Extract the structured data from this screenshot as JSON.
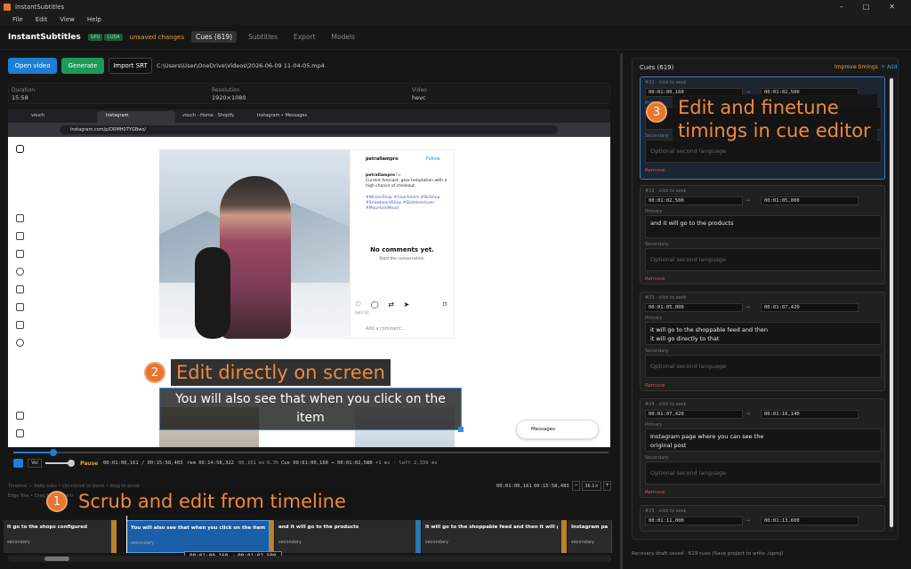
{
  "window": {
    "title": "InstantSubtitles",
    "controls": [
      "–",
      "□",
      "✕"
    ]
  },
  "menu": [
    "File",
    "Edit",
    "View",
    "Help"
  ],
  "header": {
    "app_name": "InstantSubtitles",
    "badge_gpu": "GPU",
    "badge_cuda": "CUDA",
    "unsaved": "unsaved changes",
    "tabs": [
      "Cues (619)",
      "Subtitles",
      "Export",
      "Models"
    ]
  },
  "toolbar": {
    "open_video": "Open video",
    "generate": "Generate",
    "import_srt": "Import SRT",
    "file_path": "C:\\Users\\User\\OneDrive\\Videos\\2026-06-09 11-04-05.mp4"
  },
  "info": {
    "duration_label": "Duration",
    "duration_value": "15:58",
    "resolution_label": "Resolution",
    "resolution_value": "1920×1080",
    "video_label": "Video",
    "video_value": "hevc"
  },
  "browser": {
    "tab1": "vouch",
    "tab2": "Instagram",
    "tab3": "vouch - Home · Shopify",
    "tab4": "Instagram • Messages",
    "url": "instagram.com/p/DRMH07YGBwo/"
  },
  "post": {
    "username": "petrallampro",
    "follow": "Follow",
    "caption_user": "petrallampro",
    "caption_time": "7w",
    "caption": "Current forecast: gear temptation with a high chance of checkout.",
    "hashtags": "#WinterShop #GearAddict #SkiShop #SnowboardShop #SkiAdventurer #MountainMood",
    "no_comments": "No comments yet.",
    "start_conv": "Start the conversation.",
    "date": "April 10",
    "add_comment": "Add a comment...",
    "messages": "Messages"
  },
  "subtitle_overlay": "You will also see that when you click on the item",
  "player": {
    "pause": "Pause",
    "time": "00:01:00,161 / 00:15:58,483",
    "remaining": "rem 00:14:58,322",
    "rate": "00,161 ms",
    "fps": "6.3%",
    "cue_info": "Cue 00:01:00,160 → 00:01:02,500",
    "offset": "in +1 ms · left 2,339 ms",
    "volume": "Vol"
  },
  "timeline": {
    "label": "Timeline — body subs • ctrl+scroll to zoom • drag to scrub",
    "sub_label": "Edge fine • Drag the edges to trim",
    "time_readout": "00:01:00,161",
    "end_readout": "00:15:58,483",
    "zoom": "36.1×",
    "range_readout": "00:01:00.160 → 00:01:02.500",
    "segments": [
      {
        "text": "it go to the shops configured",
        "sec": "secondary"
      },
      {
        "text": "You will also see that when you click on the item",
        "sec": "secondary"
      },
      {
        "text": "and it will go to the products",
        "sec": "secondary"
      },
      {
        "text": "it will go to the shoppable feed and then it will go directly t…",
        "sec": "secondary"
      },
      {
        "text": "Instagram page w…",
        "sec": "secondary"
      }
    ]
  },
  "cues_panel": {
    "title": "Cues (619)",
    "improve": "Improve timings",
    "add": "+ Add",
    "primary_label": "Primary",
    "secondary_label": "Secondary",
    "secondary_placeholder": "Optional second language",
    "remove": "Remove",
    "cues": [
      {
        "title": "#21 · click to seek",
        "start": "00:01:00,160",
        "end": "00:01:02,500",
        "primary": ""
      },
      {
        "title": "#22 · click to seek",
        "start": "00:01:02,500",
        "end": "00:01:05,000",
        "primary": "and it will go to the products"
      },
      {
        "title": "#23 · click to seek",
        "start": "00:01:05,000",
        "end": "00:01:07,420",
        "primary": "it will go to the shoppable feed and then\nit will go directly to that"
      },
      {
        "title": "#24 · click to seek",
        "start": "00:01:07,420",
        "end": "00:01:10,140",
        "primary": "Instagram page where you can see the\noriginal post"
      },
      {
        "title": "#25 · click to seek",
        "start": "00:01:11,000",
        "end": "00:01:13,600"
      }
    ]
  },
  "status": "Recovery draft saved · 619 cues (Save project to write .isproj)",
  "callouts": [
    {
      "num": "1",
      "text": "Scrub and edit from timeline"
    },
    {
      "num": "2",
      "text": "Edit directly on screen"
    },
    {
      "num": "3",
      "text": "Edit and finetune\ntimings in cue editor"
    }
  ],
  "colors": {
    "accent_blue": "#1d7fd4",
    "accent_green": "#1b9a5a",
    "callout_orange": "#e8752f",
    "selected_seg": "#1a5fa8"
  }
}
